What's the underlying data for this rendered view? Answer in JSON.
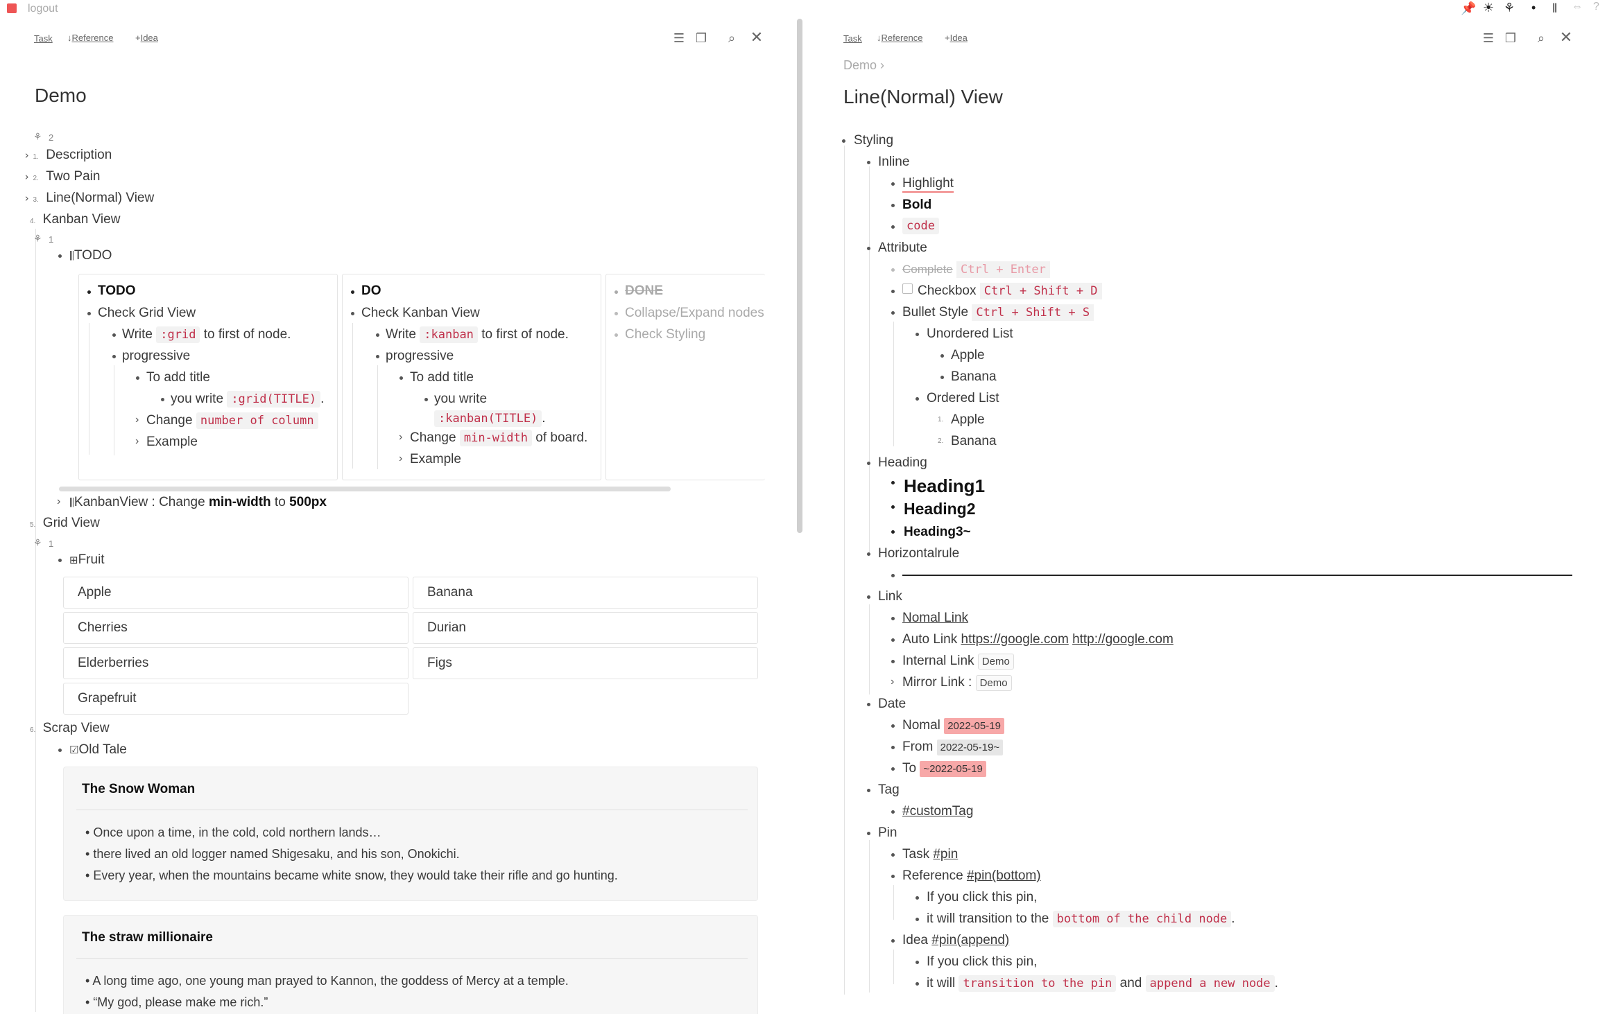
{
  "app": {
    "logout": "logout"
  },
  "left_pane": {
    "toolbar": {
      "task": "Task",
      "reference": "Reference",
      "idea": "Idea"
    },
    "title": "Demo",
    "mirror_count_top": "2",
    "items": [
      {
        "num": "1.",
        "label": "Description"
      },
      {
        "num": "2.",
        "label": "Two Pain"
      },
      {
        "num": "3.",
        "label": "Line(Normal) View"
      },
      {
        "num": "4.",
        "label": "Kanban View"
      }
    ],
    "kanban_mirror_count": "1",
    "kanban_title": "TODO",
    "kanban": {
      "todo": {
        "header": "TODO",
        "l1": "Check Grid View",
        "write_pre": "Write",
        "write_code": ":grid",
        "write_post": "to first of node.",
        "progressive": "progressive",
        "add_title": "To add title",
        "you_write": "you write",
        "you_write_code": ":grid(TITLE)",
        "change": "Change",
        "change_code": "number of column",
        "example": "Example"
      },
      "do": {
        "header": "DO",
        "l1": "Check Kanban View",
        "write_pre": "Write",
        "write_code": ":kanban",
        "write_post": "to first of node.",
        "progressive": "progressive",
        "add_title": "To add title",
        "you_write": "you write",
        "you_write_code": ":kanban(TITLE)",
        "change": "Change",
        "change_code": "min-width",
        "change_post": "of board.",
        "example": "Example"
      },
      "done": {
        "header": "DONE",
        "l1": "Collapse/Expand nodes",
        "l2": "Check Styling"
      }
    },
    "kanban_view_line": {
      "pre": "KanbanView : Change",
      "b1": "min-width",
      "mid": "to",
      "b2": "500px"
    },
    "grid_view": {
      "num": "5.",
      "label": "Grid View",
      "mirror_count": "1",
      "title": "Fruit",
      "cells": [
        "Apple",
        "Banana",
        "Cherries",
        "Durian",
        "Elderberries",
        "Figs",
        "Grapefruit"
      ]
    },
    "scrap_view": {
      "num": "6.",
      "label": "Scrap View",
      "title": "Old Tale",
      "cards": [
        {
          "title": "The Snow Woman",
          "lines": [
            "Once upon a time, in the cold, cold northern lands…",
            "there lived an old logger named Shigesaku, and his son, Onokichi.",
            "Every year, when the mountains became white snow, they would take their rifle and go hunting."
          ]
        },
        {
          "title": "The straw millionaire",
          "lines": [
            "A long time ago, one young man prayed to Kannon, the goddess of Mercy at a temple.",
            "“My god, please make me rich.”"
          ]
        }
      ]
    }
  },
  "right_pane": {
    "toolbar": {
      "task": "Task",
      "reference": "Reference",
      "idea": "Idea"
    },
    "breadcrumb": "Demo",
    "title": "Line(Normal) View",
    "styling": "Styling",
    "inline": "Inline",
    "highlight": "Highlight",
    "bold": "Bold",
    "code": "code",
    "attribute": "Attribute",
    "complete": "Complete",
    "complete_kbd": "Ctrl + Enter",
    "checkbox": "Checkbox",
    "checkbox_kbd": "Ctrl + Shift + D",
    "bullet_style": "Bullet Style",
    "bullet_kbd": "Ctrl + Shift + S",
    "unordered": "Unordered List",
    "apple": "Apple",
    "banana": "Banana",
    "ordered": "Ordered List",
    "ord1": "1.",
    "ord2": "2.",
    "heading": "Heading",
    "h1": "Heading1",
    "h2": "Heading2",
    "h3": "Heading3~",
    "hr": "Horizontalrule",
    "link": "Link",
    "normal_link": "Nomal Link",
    "auto_link": "Auto Link",
    "url1": "https://google.com",
    "url2": "http://google.com",
    "internal_link": "Internal Link",
    "internal_target": "Demo",
    "mirror_link": "Mirror Link :",
    "mirror_target": "Demo",
    "date": "Date",
    "nomal": "Nomal",
    "date1": "2022-05-19",
    "from": "From",
    "date2": "2022-05-19~",
    "to": "To",
    "date3": "~2022-05-19",
    "tag": "Tag",
    "custom_tag": "#customTag",
    "pin": "Pin",
    "task": "Task",
    "pin_tag": "#pin",
    "reference": "Reference",
    "pin_bottom": "#pin(bottom)",
    "if_click": "If you click this pin,",
    "transition_pre": "it will transition to the",
    "transition_code": "bottom of the child node",
    "idea": "Idea",
    "pin_append": "#pin(append)",
    "if_click2": "If you click this pin,",
    "it_will": "it will",
    "code_transition": "transition to the pin",
    "and": "and",
    "code_append": "append a new node",
    "period": "."
  }
}
